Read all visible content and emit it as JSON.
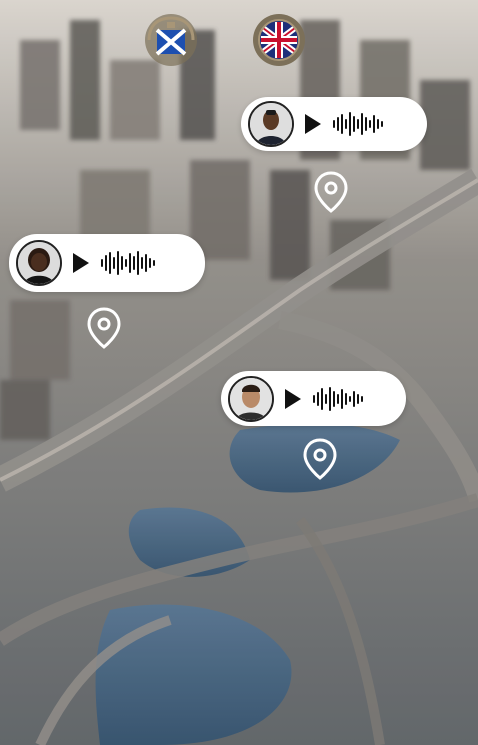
{
  "badges": [
    {
      "name": "scotland-flag-emblem",
      "colors": {
        "field": "#1d4fb0",
        "cross": "#ffffff",
        "laurel": "#8a7b62"
      }
    },
    {
      "name": "union-jack-emblem",
      "colors": {
        "blue": "#1d2f7a",
        "red": "#c8102e",
        "white": "#ffffff",
        "rim": "#8a7b62"
      }
    }
  ],
  "voice_messages": [
    {
      "id": "voice-message-1",
      "avatar": "person-avatar",
      "icon": "play-icon"
    },
    {
      "id": "voice-message-2",
      "avatar": "person-avatar",
      "icon": "play-icon"
    },
    {
      "id": "voice-message-3",
      "avatar": "person-avatar",
      "icon": "play-icon"
    }
  ],
  "pins": [
    {
      "icon": "location-pin-icon"
    },
    {
      "icon": "location-pin-icon"
    },
    {
      "icon": "location-pin-icon"
    }
  ],
  "colors": {
    "bubble": "#ffffff",
    "pin": "#ffffff",
    "wave": "#111111"
  }
}
